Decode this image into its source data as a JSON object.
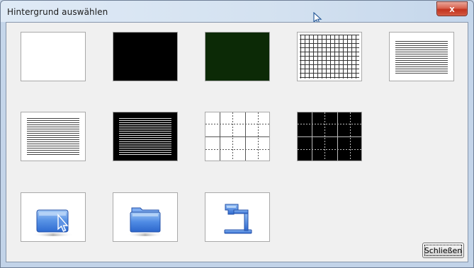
{
  "window": {
    "title": "Hintergrund auswählen",
    "close_glyph": "x"
  },
  "backgrounds": [
    {
      "name": "white",
      "icon": "blank-white"
    },
    {
      "name": "black",
      "icon": "blank-black"
    },
    {
      "name": "green",
      "icon": "blank-green",
      "color": "#0c2a06"
    },
    {
      "name": "grid",
      "icon": "square-grid"
    },
    {
      "name": "lines-narrow",
      "icon": "ruled-lines"
    },
    {
      "name": "lines-wide",
      "icon": "ruled-lines"
    },
    {
      "name": "lines-black",
      "icon": "ruled-lines-on-black"
    },
    {
      "name": "grid-dotted-white",
      "icon": "dotted-grid"
    },
    {
      "name": "grid-dotted-black",
      "icon": "dotted-grid-on-black"
    },
    {
      "name": "screen",
      "icon": "screen-with-cursor-icon"
    },
    {
      "name": "folder",
      "icon": "folder-icon"
    },
    {
      "name": "document-camera",
      "icon": "document-camera-icon"
    }
  ],
  "buttons": {
    "close_label": "Schließen"
  }
}
